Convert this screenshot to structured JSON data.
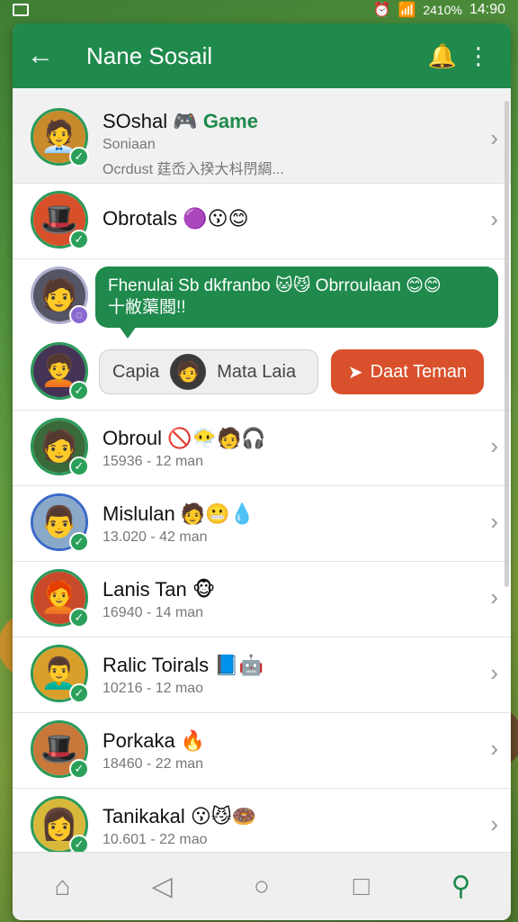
{
  "status_bar": {
    "signal": "2410%",
    "time": "14:90"
  },
  "app_bar": {
    "back": "←",
    "title": "Nane Sosail"
  },
  "first_item": {
    "name": "SOshal",
    "game": "Game",
    "line1": "Soniaan",
    "line2": "Ocrdust",
    "line2_text": "莛岙入揆大枓閅綢..."
  },
  "items": [
    {
      "name": "Obrotals",
      "emojis": "🟣😗😊",
      "sub": ""
    },
    {
      "name": "Obroul",
      "emojis": "🚫😶‍🌫️🧑🎧",
      "sub": "15936 - 12 man"
    },
    {
      "name": "Mislulan",
      "emojis": "🧑😬💧",
      "sub": "13.020 - 42 man"
    },
    {
      "name": "Lanis Tan",
      "emojis": "🐵",
      "sub": "16940 - 14 man"
    },
    {
      "name": "Ralic Toirals",
      "emojis": "📘🤖",
      "sub": "10216 - 12 mao"
    },
    {
      "name": "Porkaka",
      "emojis": "🔥",
      "sub": "18460 - 22 man"
    },
    {
      "name": "Tanikakal",
      "emojis": "😗😼🍩",
      "sub": "10.601 - 22 mao"
    }
  ],
  "bubble": {
    "line1": "Fhenulai Sb dkfranbo 🐱😼 Obrroulaan 😊😊",
    "line2": "十敝蕖閸!!"
  },
  "actions": {
    "cancel": "Capia",
    "cancel_name": "Mata Laia",
    "add": "Daat Teman"
  },
  "avatar_emojis": [
    "🧑‍💼",
    "🎩",
    "🧑",
    "🧑‍🦱",
    "🧑",
    "👨",
    "🧑‍🦰",
    "👨‍🦱",
    "🎩",
    "👩"
  ],
  "colors": {
    "primary": "#1f8a4c",
    "accent": "#d9512c"
  }
}
